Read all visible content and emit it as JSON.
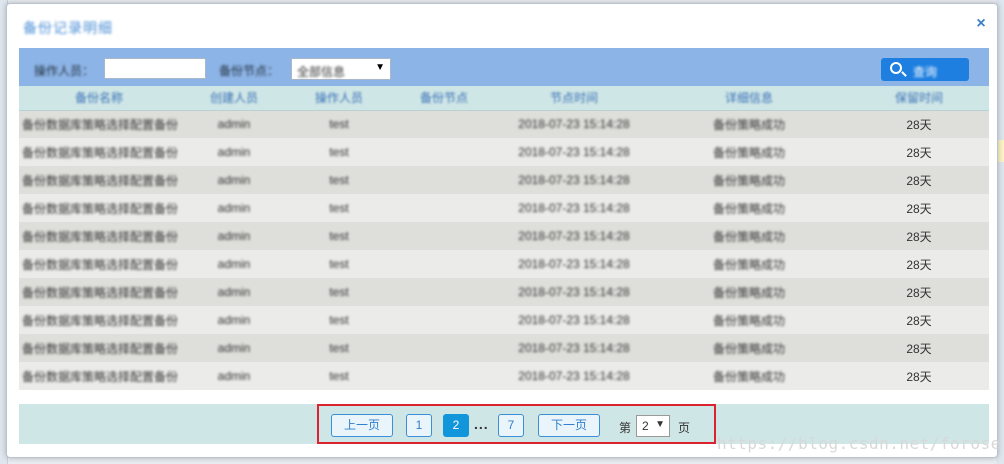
{
  "dialog": {
    "title": "备份记录明细",
    "close_glyph": "×"
  },
  "toolbar": {
    "operator_label": "操作人员：",
    "operator_value": "",
    "node_label": "备份节点：",
    "node_selected": "全部信息",
    "search_label": "查询"
  },
  "table": {
    "headers": [
      "备份名称",
      "创建人员",
      "操作人员",
      "备份节点",
      "节点时间",
      "详细信息",
      "保留时间"
    ],
    "rows": [
      [
        "备份数据库策略选择配置备份",
        "admin",
        "test",
        "",
        "2018-07-23 15:14:28",
        "备份策略成功",
        "28天"
      ],
      [
        "备份数据库策略选择配置备份",
        "admin",
        "test",
        "",
        "2018-07-23 15:14:28",
        "备份策略成功",
        "28天"
      ],
      [
        "备份数据库策略选择配置备份",
        "admin",
        "test",
        "",
        "2018-07-23 15:14:28",
        "备份策略成功",
        "28天"
      ],
      [
        "备份数据库策略选择配置备份",
        "admin",
        "test",
        "",
        "2018-07-23 15:14:28",
        "备份策略成功",
        "28天"
      ],
      [
        "备份数据库策略选择配置备份",
        "admin",
        "test",
        "",
        "2018-07-23 15:14:28",
        "备份策略成功",
        "28天"
      ],
      [
        "备份数据库策略选择配置备份",
        "admin",
        "test",
        "",
        "2018-07-23 15:14:28",
        "备份策略成功",
        "28天"
      ],
      [
        "备份数据库策略选择配置备份",
        "admin",
        "test",
        "",
        "2018-07-23 15:14:28",
        "备份策略成功",
        "28天"
      ],
      [
        "备份数据库策略选择配置备份",
        "admin",
        "test",
        "",
        "2018-07-23 15:14:28",
        "备份策略成功",
        "28天"
      ],
      [
        "备份数据库策略选择配置备份",
        "admin",
        "test",
        "",
        "2018-07-23 15:14:28",
        "备份策略成功",
        "28天"
      ],
      [
        "备份数据库策略选择配置备份",
        "admin",
        "test",
        "",
        "2018-07-23 15:14:28",
        "备份策略成功",
        "28天"
      ]
    ]
  },
  "pager": {
    "prev_label": "上一页",
    "pages": [
      "1",
      "2",
      "7"
    ],
    "current_page": "2",
    "ellipsis": "...",
    "next_label": "下一页",
    "jump_prefix": "第",
    "jump_value": "2",
    "jump_suffix": "页"
  },
  "watermark": "https://blog.csdn.net/forose",
  "colors": {
    "accent": "#1296db",
    "toolbar_bg": "#8db4e6",
    "header_bg": "#cfe6e6",
    "highlight_border": "#d9232e"
  },
  "icons": {
    "search": "search-icon",
    "close": "close-icon",
    "dropdown": "chevron-down-icon"
  }
}
